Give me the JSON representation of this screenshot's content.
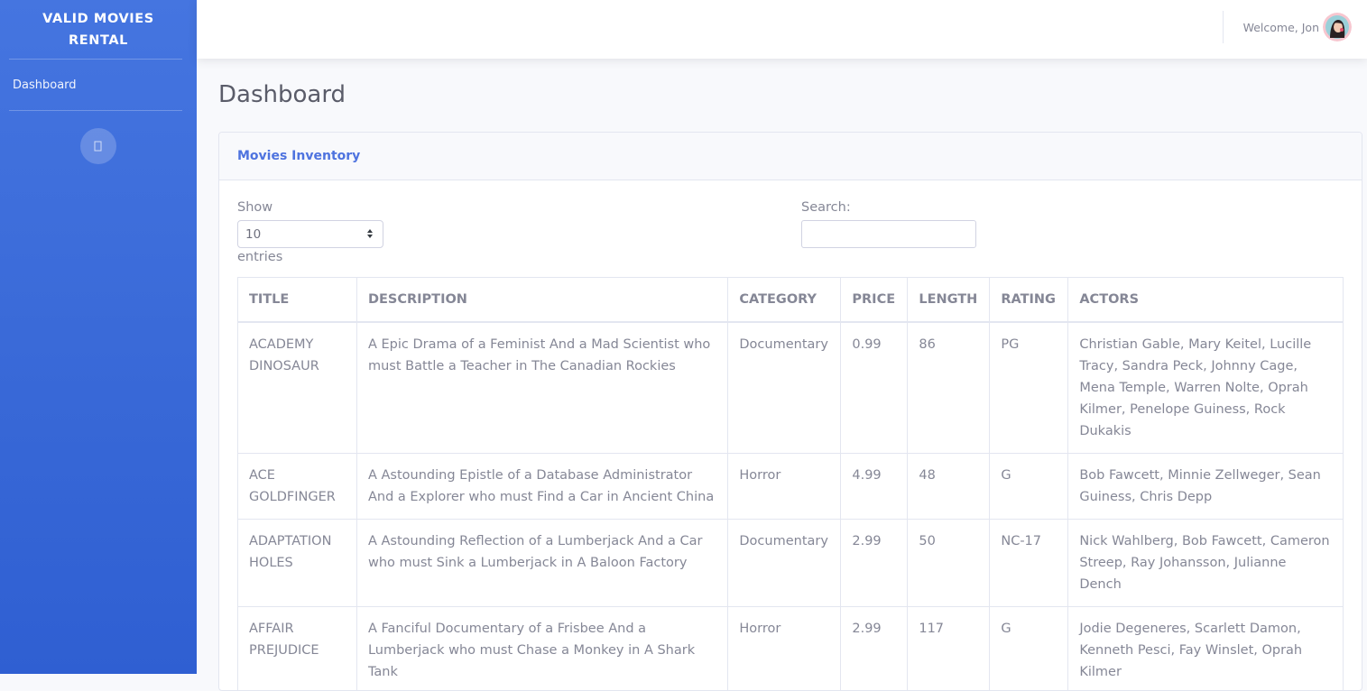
{
  "sidebar": {
    "brand": "VALID MOVIES RENTAL",
    "items": [
      {
        "label": "Dashboard"
      }
    ],
    "toggle_icon": "chevron-left-icon"
  },
  "topbar": {
    "welcome": "Welcome, Jon",
    "avatar": "avatar-icon"
  },
  "page": {
    "title": "Dashboard"
  },
  "card": {
    "title": "Movies Inventory",
    "show_label": "Show",
    "show_value": "10",
    "entries_label": "entries",
    "search_label": "Search:",
    "search_value": ""
  },
  "table": {
    "columns": [
      "TITLE",
      "DESCRIPTION",
      "CATEGORY",
      "PRICE",
      "LENGTH",
      "RATING",
      "ACTORS"
    ],
    "rows": [
      {
        "title": "ACADEMY DINOSAUR",
        "description": "A Epic Drama of a Feminist And a Mad Scientist who must Battle a Teacher in The Canadian Rockies",
        "category": "Documentary",
        "price": "0.99",
        "length": "86",
        "rating": "PG",
        "actors": "Christian Gable, Mary Keitel, Lucille Tracy, Sandra Peck, Johnny Cage, Mena Temple, Warren Nolte, Oprah Kilmer, Penelope Guiness, Rock Dukakis"
      },
      {
        "title": "ACE GOLDFINGER",
        "description": "A Astounding Epistle of a Database Administrator And a Explorer who must Find a Car in Ancient China",
        "category": "Horror",
        "price": "4.99",
        "length": "48",
        "rating": "G",
        "actors": "Bob Fawcett, Minnie Zellweger, Sean Guiness, Chris Depp"
      },
      {
        "title": "ADAPTATION HOLES",
        "description": "A Astounding Reflection of a Lumberjack And a Car who must Sink a Lumberjack in A Baloon Factory",
        "category": "Documentary",
        "price": "2.99",
        "length": "50",
        "rating": "NC-17",
        "actors": "Nick Wahlberg, Bob Fawcett, Cameron Streep, Ray Johansson, Julianne Dench"
      },
      {
        "title": "AFFAIR PREJUDICE",
        "description": "A Fanciful Documentary of a Frisbee And a Lumberjack who must Chase a Monkey in A Shark Tank",
        "category": "Horror",
        "price": "2.99",
        "length": "117",
        "rating": "G",
        "actors": "Jodie Degeneres, Scarlett Damon, Kenneth Pesci, Fay Winslet, Oprah Kilmer"
      }
    ]
  },
  "colors": {
    "primary": "#4e73df",
    "sidebar_top": "#4575e0",
    "sidebar_bottom": "#2f5fd2",
    "text": "#858796",
    "background": "#f8f9fc"
  }
}
